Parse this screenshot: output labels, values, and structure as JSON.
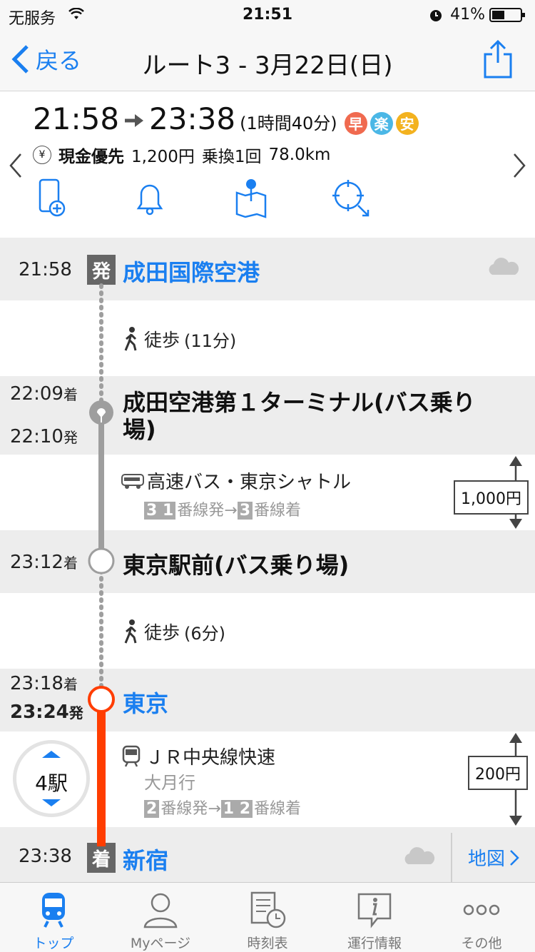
{
  "status_bar": {
    "carrier": "无服务",
    "time": "21:51",
    "battery": "41%"
  },
  "nav": {
    "back_label": "戻る",
    "title": "ルート3 - 3月22日(日)"
  },
  "summary": {
    "depart": "21:58",
    "arrive": "23:38",
    "duration": "(1時間40分)",
    "badges": [
      {
        "label": "早",
        "color": "#f06a4f"
      },
      {
        "label": "楽",
        "color": "#4bb7e6"
      },
      {
        "label": "安",
        "color": "#f3b21f"
      }
    ],
    "fare_mode": "現金優先",
    "fare": "1,200円",
    "transfers": "乗換1回",
    "distance": "78.0km"
  },
  "stops": {
    "s1": {
      "time": "21:58",
      "tag": "発",
      "name": "成田国際空港"
    },
    "walk1": "徒歩",
    "walk1_dur": "(11分)",
    "s2": {
      "arr_time": "22:09",
      "arr_suffix": "着",
      "dep_time": "22:10",
      "dep_suffix": "発",
      "name_line1": "成田空港第１ターミナル(バス乗り",
      "name_line2": "場)"
    },
    "seg1": {
      "line": "高速バス・東京シャトル",
      "plat_from": "3 1",
      "plat_from_suffix": "番線発→",
      "plat_to": "3",
      "plat_to_suffix": "番線着",
      "fare": "1,000円"
    },
    "s3": {
      "arr_time": "23:12",
      "arr_suffix": "着",
      "name": "東京駅前(バス乗り場)"
    },
    "walk2": "徒歩",
    "walk2_dur": "(6分)",
    "s4": {
      "arr_time": "23:18",
      "arr_suffix": "着",
      "dep_time": "23:24",
      "dep_suffix": "発",
      "name": "東京"
    },
    "seg2": {
      "stations": "4駅",
      "line": "ＪＲ中央線快速",
      "dest": "大月行",
      "plat_from": "2",
      "plat_from_suffix": "番線発→",
      "plat_to": "1 2",
      "plat_to_suffix": "番線着",
      "fare": "200円"
    },
    "s5": {
      "time": "23:38",
      "tag": "着",
      "name": "新宿",
      "map_label": "地図"
    }
  },
  "tabs": [
    {
      "label": "トップ",
      "icon": "train-icon",
      "active": true
    },
    {
      "label": "Myページ",
      "icon": "person-icon",
      "active": false
    },
    {
      "label": "時刻表",
      "icon": "timetable-icon",
      "active": false
    },
    {
      "label": "運行情報",
      "icon": "info-icon",
      "active": false
    },
    {
      "label": "その他",
      "icon": "more-icon",
      "active": false
    }
  ],
  "colors": {
    "accent": "#1a7ff0",
    "rail_gray": "#9e9e9e",
    "rail_orange": "#ff3d00"
  }
}
